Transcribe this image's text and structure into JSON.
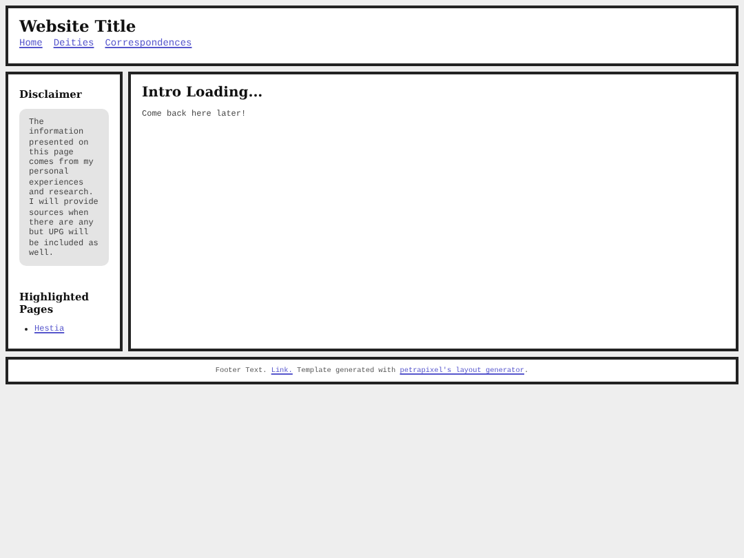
{
  "header": {
    "title": "Website Title",
    "nav": [
      "Home",
      "Deities",
      "Correspondences"
    ]
  },
  "sidebar": {
    "disclaimer_heading": "Disclaimer",
    "disclaimer_text": "The information presented on this page comes from my personal experiences and research. I will provide sources when there are any but UPG will be included as well.",
    "highlighted_heading": "Highlighted Pages",
    "highlighted_links": [
      "Hestia"
    ]
  },
  "main": {
    "heading": "Intro Loading...",
    "text": "Come back here later!"
  },
  "footer": {
    "parts": [
      {
        "kind": "text",
        "text": "Footer Text. "
      },
      {
        "kind": "link",
        "text": "Link."
      },
      {
        "kind": "text",
        "text": " Template generated with "
      },
      {
        "kind": "link",
        "text": "petrapixel's layout generator"
      },
      {
        "kind": "text",
        "text": "."
      }
    ]
  }
}
